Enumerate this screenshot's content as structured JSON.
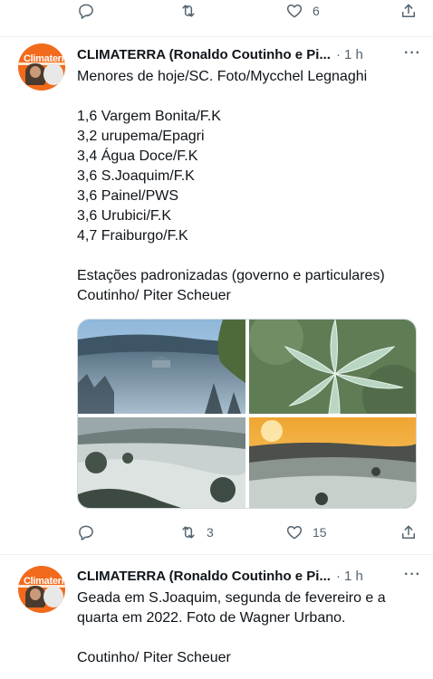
{
  "top_actions": {
    "reply_count": "",
    "retweet_count": "",
    "like_count": "6"
  },
  "tweets": [
    {
      "author": "CLIMATERRA (Ronaldo Coutinho e Pi...",
      "time": "1 h",
      "more": "···",
      "avatar_logo": "Climaterra",
      "text": "Menores de hoje/SC. Foto/Mycchel Legnaghi\n\n1,6 Vargem Bonita/F.K\n3,2 urupema/Epagri\n3,4 Água Doce/F.K\n3,6 S.Joaquim/F.K\n3,6 Painel/PWS\n3,6 Urubici/F.K\n4,7 Fraiburgo/F.K\n\nEstações padronizadas (governo e particulares)\nCoutinho/ Piter Scheuer",
      "media": [
        "frost-field-cabin-photo",
        "frost-leaf-closeup-photo",
        "frost-valley-trees-photo",
        "sunrise-frost-hills-photo"
      ],
      "actions": {
        "reply_count": "",
        "retweet_count": "3",
        "like_count": "15"
      }
    },
    {
      "author": "CLIMATERRA (Ronaldo Coutinho e Pi...",
      "time": "1 h",
      "more": "···",
      "avatar_logo": "Climaterra",
      "text": "Geada em S.Joaquim, segunda de fevereiro e a quarta em 2022. Foto de Wagner Urbano.\n\nCoutinho/ Piter Scheuer"
    }
  ],
  "colors": {
    "text": "#0f1419",
    "muted": "#536471",
    "divider": "#eff3f4",
    "avatar_bg": "#f26a1b"
  }
}
